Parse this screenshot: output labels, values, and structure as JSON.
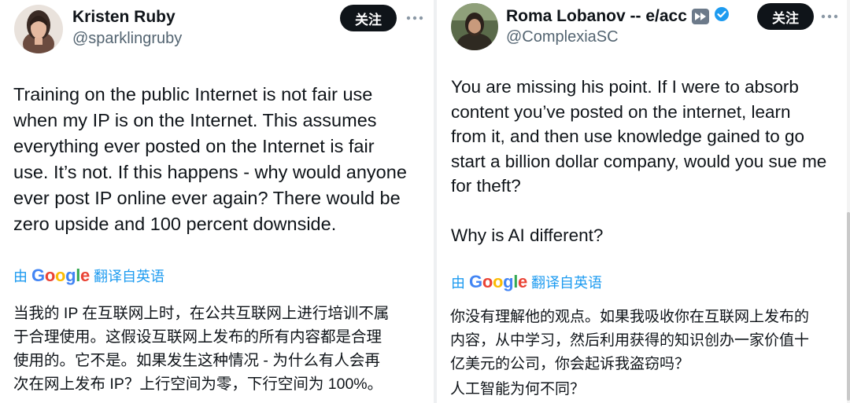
{
  "left_tweet": {
    "author": {
      "name": "Kristen Ruby",
      "handle": "@sparklingruby"
    },
    "follow_label": "关注",
    "body_lines": [
      "Training on the public Internet is not fair use",
      "when my IP is on the Internet. This assumes",
      "everything ever posted on the Internet is fair",
      "use. It’s not. If this happens - why would anyone",
      "ever post IP online ever again? There would be",
      "zero upside and 100 percent downside."
    ],
    "translate": {
      "prefix": "由",
      "brand": "Google",
      "suffix": "翻译自英语"
    },
    "translated_lines": [
      "当我的 IP 在互联网上时，在公共互联网上进行培训不属",
      "于合理使用。这假设互联网上发布的所有内容都是合理",
      "使用的。它不是。如果发生这种情况 - 为什么有人会再",
      "次在网上发布 IP？上行空间为零，下行空间为 100%。"
    ]
  },
  "right_tweet": {
    "author": {
      "name": "Roma Lobanov -- e/acc",
      "handle": "@ComplexiaSC"
    },
    "follow_label": "关注",
    "body_lines": [
      "You are missing his point. If I were to absorb",
      "content you’ve posted on the internet, learn",
      "from it, and then use knowledge gained to go",
      "start a billion dollar company, would you sue me",
      "for theft?"
    ],
    "body_last": "Why is AI different?",
    "translate": {
      "prefix": "由",
      "brand": "Google",
      "suffix": "翻译自英语"
    },
    "translated_lines": [
      "你没有理解他的观点。如果我吸收你在互联网上发布的",
      "内容，从中学习，然后利用获得的知识创办一家价值十",
      "亿美元的公司，你会起诉我盗窃吗？",
      "人工智能为何不同？"
    ]
  },
  "colors": {
    "link": "#1d9bf0",
    "text": "#0f1419",
    "muted": "#536471",
    "button": "#0f1419",
    "verified": "#1d9bf0"
  },
  "google_colors": [
    "#4285F4",
    "#EA4335",
    "#FBBC05",
    "#4285F4",
    "#34A853",
    "#EA4335"
  ]
}
